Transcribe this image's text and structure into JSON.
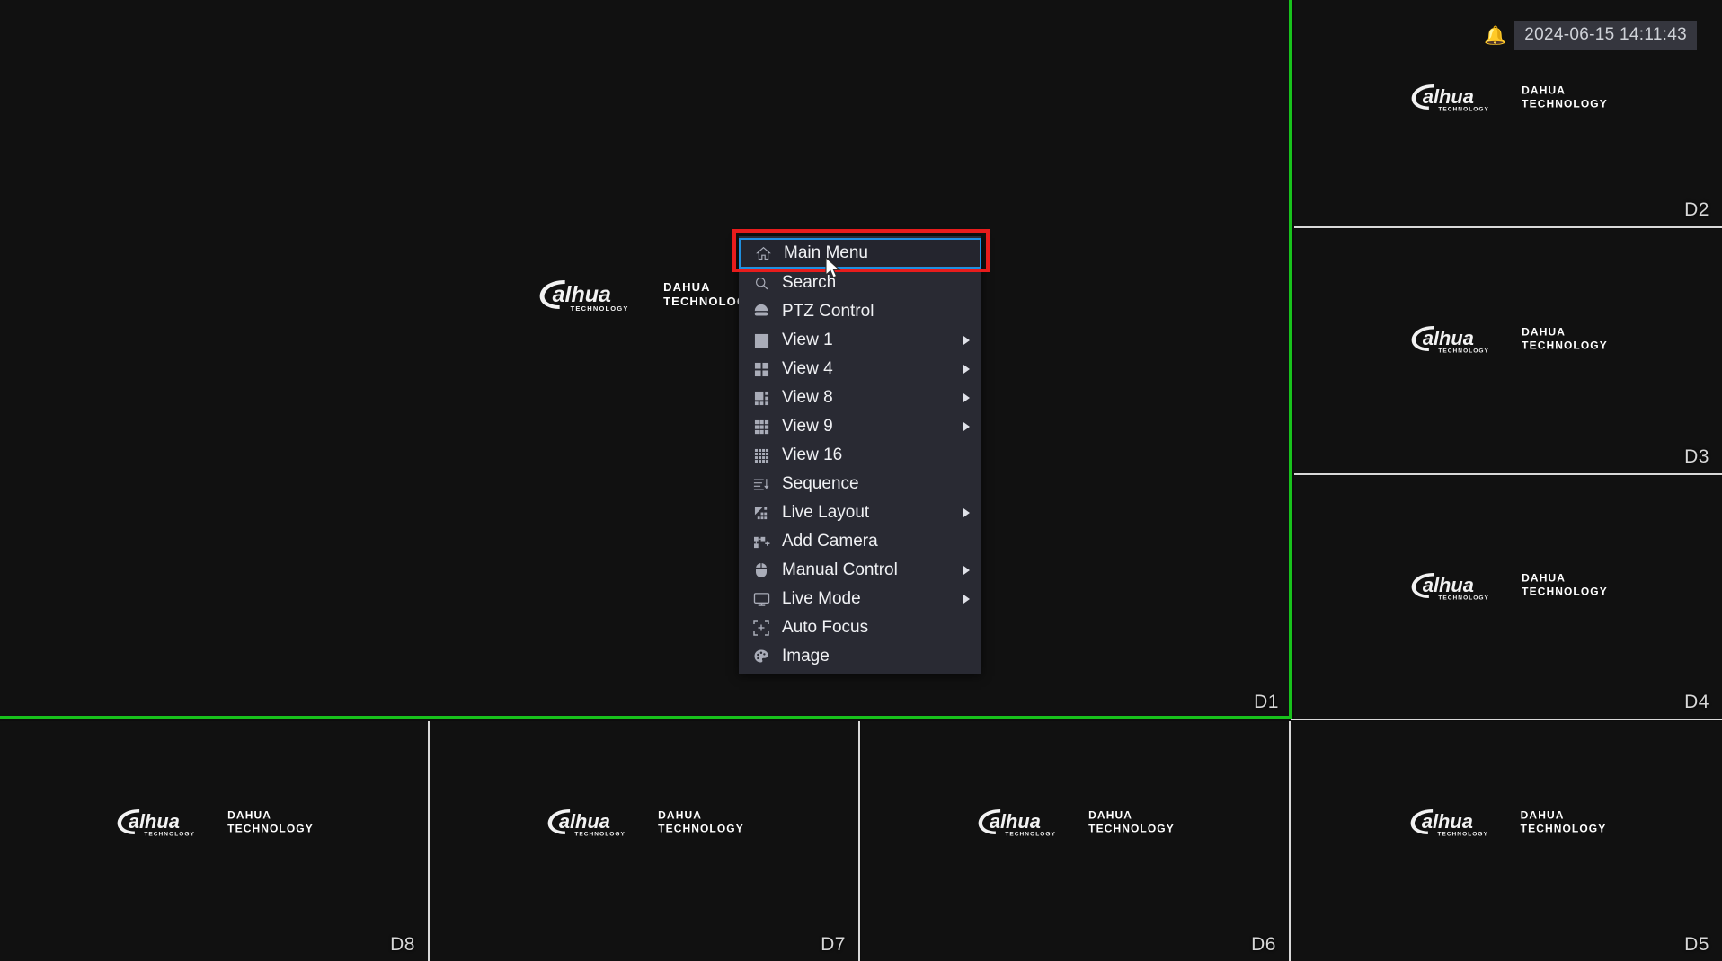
{
  "osd": {
    "alarm_icon": "bell-icon",
    "timestamp": "2024-06-15 14:11:43",
    "alarm_color": "#e02020"
  },
  "branding": {
    "wordmark": "alhua",
    "wordmark_sub": "TECHNOLOGY",
    "name_line1": "DAHUA",
    "name_line2": "TECHNOLOGY"
  },
  "video_wall": {
    "selected_channel": "D1",
    "selection_color": "#18c21c",
    "panes": [
      {
        "label": "D1"
      },
      {
        "label": "D2"
      },
      {
        "label": "D3"
      },
      {
        "label": "D4"
      },
      {
        "label": "D5"
      },
      {
        "label": "D6"
      },
      {
        "label": "D7"
      },
      {
        "label": "D8"
      }
    ]
  },
  "context_menu": {
    "highlight_border_color": "#1f8fe0",
    "annotation_color": "#e81c1c",
    "items": [
      {
        "label": "Main Menu",
        "icon": "home-icon",
        "submenu": false,
        "selected": true
      },
      {
        "label": "Search",
        "icon": "search-icon",
        "submenu": false,
        "selected": false
      },
      {
        "label": "PTZ Control",
        "icon": "dome-camera-icon",
        "submenu": false,
        "selected": false
      },
      {
        "label": "View 1",
        "icon": "grid-1-icon",
        "submenu": true,
        "selected": false
      },
      {
        "label": "View 4",
        "icon": "grid-4-icon",
        "submenu": true,
        "selected": false
      },
      {
        "label": "View 8",
        "icon": "grid-8-icon",
        "submenu": true,
        "selected": false
      },
      {
        "label": "View 9",
        "icon": "grid-9-icon",
        "submenu": true,
        "selected": false
      },
      {
        "label": "View 16",
        "icon": "grid-16-icon",
        "submenu": false,
        "selected": false
      },
      {
        "label": "Sequence",
        "icon": "sequence-icon",
        "submenu": false,
        "selected": false
      },
      {
        "label": "Live Layout",
        "icon": "live-layout-icon",
        "submenu": true,
        "selected": false
      },
      {
        "label": "Add Camera",
        "icon": "add-camera-icon",
        "submenu": false,
        "selected": false
      },
      {
        "label": "Manual Control",
        "icon": "mouse-icon",
        "submenu": true,
        "selected": false
      },
      {
        "label": "Live Mode",
        "icon": "monitor-icon",
        "submenu": true,
        "selected": false
      },
      {
        "label": "Auto Focus",
        "icon": "auto-focus-icon",
        "submenu": false,
        "selected": false
      },
      {
        "label": "Image",
        "icon": "palette-icon",
        "submenu": false,
        "selected": false
      }
    ]
  }
}
